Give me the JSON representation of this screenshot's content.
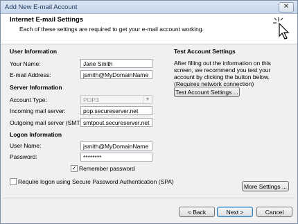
{
  "window": {
    "title": "Add New E-mail Account",
    "close_label": "✕"
  },
  "header": {
    "title": "Internet E-mail Settings",
    "subtitle": "Each of these settings are required to get your e-mail account working."
  },
  "user_info": {
    "section": "User Information",
    "name_label": "Your Name:",
    "name_value": "Jane Smith",
    "email_label": "E-mail Address:",
    "email_value": "jsmith@MyDomainName"
  },
  "server_info": {
    "section": "Server Information",
    "account_type_label": "Account Type:",
    "account_type_value": "POP3",
    "incoming_label": "Incoming mail server:",
    "incoming_value": "pop.secureserver.net",
    "outgoing_label": "Outgoing mail server (SMTP):",
    "outgoing_value": "smtpout.secureserver.net"
  },
  "logon_info": {
    "section": "Logon Information",
    "username_label": "User Name:",
    "username_value": "jsmith@MyDomainName",
    "password_label": "Password:",
    "password_value": "********",
    "remember_label": "Remember password",
    "remember_checked": true,
    "spa_label": "Require logon using Secure Password Authentication (SPA)",
    "spa_checked": false
  },
  "test_settings": {
    "section": "Test Account Settings",
    "description": "After filling out the information on this screen, we recommend you test your account by clicking the button below. (Requires network connection)",
    "button_label": "Test Account Settings ..."
  },
  "buttons": {
    "more_settings": "More Settings ...",
    "back": "< Back",
    "next": "Next >",
    "cancel": "Cancel"
  }
}
